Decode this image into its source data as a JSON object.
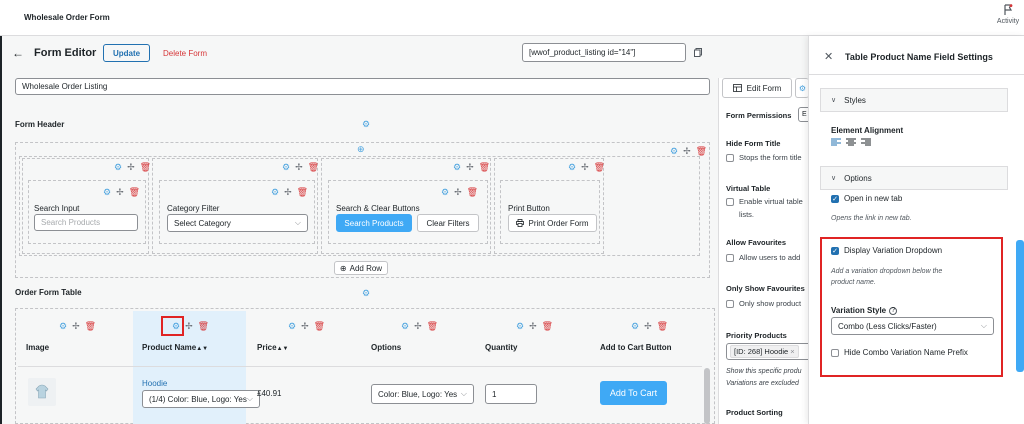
{
  "topbar": {
    "title": "Wholesale Order Form",
    "activity_label": "Activity"
  },
  "editor": {
    "title": "Form Editor",
    "update_label": "Update",
    "delete_label": "Delete Form",
    "shortcode": "[wwof_product_listing id=\"14\"]",
    "form_name": "Wholesale Order Listing"
  },
  "form_header": {
    "label": "Form Header",
    "search_input": {
      "label": "Search Input",
      "placeholder": "Search Products"
    },
    "category_filter": {
      "label": "Category Filter",
      "value": "Select Category"
    },
    "search_clear": {
      "label": "Search & Clear Buttons",
      "search": "Search Products",
      "clear": "Clear Filters"
    },
    "print_button": {
      "label": "Print Button",
      "text": "Print Order Form"
    },
    "add_row": "Add Row"
  },
  "order_table": {
    "label": "Order Form Table",
    "columns": [
      "Image",
      "Product Name",
      "Price",
      "Options",
      "Quantity",
      "Add to Cart Button"
    ],
    "sort_glyph": "▲▼",
    "row": {
      "product": "Hoodie",
      "variation": "(1/4) Color: Blue, Logo: Yes",
      "price": "£40.91",
      "options": "Color: Blue, Logo: Yes",
      "quantity": "1",
      "add_to_cart": "Add To Cart"
    }
  },
  "sidebar": {
    "tab_edit": "Edit Form",
    "form_permissions": "Form Permissions",
    "form_permissions_value": "E",
    "hide_title": "Hide Form Title",
    "hide_title_desc": "Stops the form title",
    "virtual_table": "Virtual Table",
    "virtual_desc1": "Enable virtual table",
    "virtual_desc2": "lists.",
    "allow_fav": "Allow Favourites",
    "allow_fav_desc": "Allow users to add",
    "only_fav": "Only Show Favourites",
    "only_fav_desc": "Only show product",
    "priority": "Priority Products",
    "priority_tag": "[ID: 268] Hoodie",
    "priority_note1": "Show this specific produ",
    "priority_note2": "Variations are excluded",
    "sorting": "Product Sorting"
  },
  "panel": {
    "title": "Table Product Name Field Settings",
    "styles": "Styles",
    "alignment": "Element Alignment",
    "options": "Options",
    "open_new_tab": "Open in new tab",
    "open_new_tab_desc": "Opens the link in new tab.",
    "display_variation": "Display Variation Dropdown",
    "display_variation_desc1": "Add a variation dropdown below the",
    "display_variation_desc2": "product name.",
    "variation_style": "Variation Style",
    "variation_style_value": "Combo (Less Clicks/Faster)",
    "hide_combo": "Hide Combo Variation Name Prefix"
  },
  "colors": {
    "accent": "#3fa9f5",
    "link": "#2271b1",
    "danger": "#d63638",
    "highlight": "#e02424"
  }
}
